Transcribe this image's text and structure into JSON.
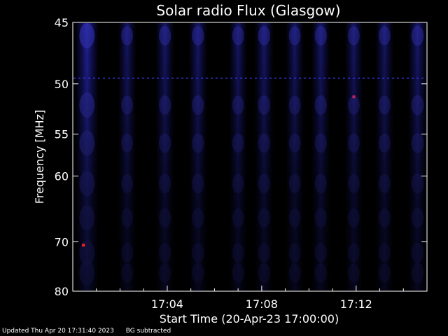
{
  "chart_data": {
    "type": "heatmap",
    "title": "Solar radio Flux (Glasgow)",
    "xlabel": "Start Time (20-Apr-23 17:00:00)",
    "ylabel": "Frequency [MHz]",
    "x_unit": "minutes after 17:00:00",
    "xlim": [
      0,
      15
    ],
    "ylim": [
      80,
      45
    ],
    "y_scale": "reciprocal",
    "x_ticks": [
      {
        "value": 4,
        "label": "17:04"
      },
      {
        "value": 8,
        "label": "17:08"
      },
      {
        "value": 12,
        "label": "17:12"
      }
    ],
    "y_ticks": [
      {
        "value": 45,
        "label": "45"
      },
      {
        "value": 50,
        "label": "50"
      },
      {
        "value": 55,
        "label": "55"
      },
      {
        "value": 60,
        "label": "60"
      },
      {
        "value": 70,
        "label": "70"
      },
      {
        "value": 80,
        "label": "80"
      }
    ],
    "grid": false,
    "colors": {
      "background": "#000000",
      "emission": "#1a1aa0",
      "peak": "#ff2020",
      "axes": "#ffffff"
    },
    "bands": [
      {
        "t": 0.6,
        "intensity": 1.0
      },
      {
        "t": 2.3,
        "intensity": 0.45
      },
      {
        "t": 3.9,
        "intensity": 0.5
      },
      {
        "t": 5.3,
        "intensity": 0.5
      },
      {
        "t": 7.0,
        "intensity": 0.45
      },
      {
        "t": 8.1,
        "intensity": 0.5
      },
      {
        "t": 9.4,
        "intensity": 0.45
      },
      {
        "t": 10.5,
        "intensity": 0.5
      },
      {
        "t": 11.9,
        "intensity": 0.45
      },
      {
        "t": 13.2,
        "intensity": 0.45
      },
      {
        "t": 14.6,
        "intensity": 0.55
      }
    ],
    "hot_spots": [
      {
        "t": 0.45,
        "freq": 70.6,
        "color": "#ff2020"
      },
      {
        "t": 11.9,
        "freq": 51.2,
        "color": "#c02060"
      }
    ],
    "interference_line_freq": 49.5
  },
  "footer": {
    "updated": "Updated Thu Apr 20 17:31:40 2023",
    "note": "BG subtracted"
  }
}
